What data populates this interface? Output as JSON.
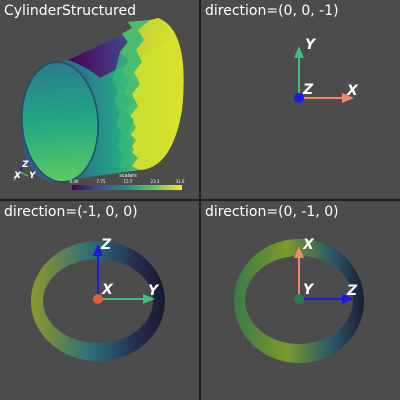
{
  "panes": [
    {
      "title": "CylinderStructured"
    },
    {
      "title": "direction=(0, 0, -1)"
    },
    {
      "title": "direction=(-1, 0, 0)"
    },
    {
      "title": "direction=(0, -1, 0)"
    }
  ],
  "scalar_bar": {
    "title": "scalars",
    "ticks": [
      "0.00",
      "7.75",
      "15.5",
      "23.3",
      "31.0"
    ]
  },
  "mini_axes": {
    "x": "X",
    "y": "Y",
    "z": "Z"
  },
  "axes_labels": {
    "top_right": {
      "up": "Y",
      "right": "X",
      "center": "Z"
    },
    "bottom_left": {
      "up": "Z",
      "right": "Y",
      "center": "X"
    },
    "bottom_right": {
      "up": "X",
      "right": "Z",
      "center": "Y"
    }
  },
  "colors": {
    "background": "#4c4c4c",
    "divider": "#1e1e1e",
    "x_axis": "#f08a6a",
    "y_axis": "#3fbf7f",
    "z_axis": "#1a1ae0",
    "viridis_low": "#440154",
    "viridis_high": "#fde725"
  }
}
